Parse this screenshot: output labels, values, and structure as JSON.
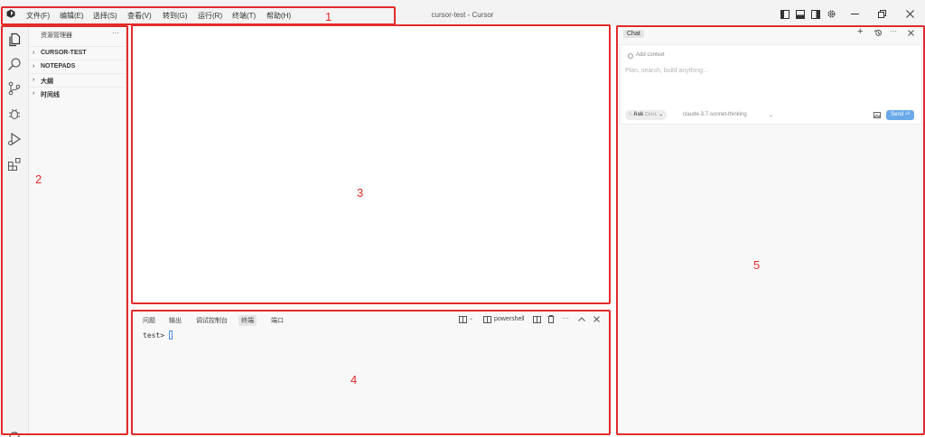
{
  "window": {
    "title": "cursor-test - Cursor",
    "menu": [
      "文件(F)",
      "编辑(E)",
      "选择(S)",
      "查看(V)",
      "转到(G)",
      "运行(R)",
      "终端(T)",
      "帮助(H)"
    ]
  },
  "activity_bar": {
    "icons": [
      "explorer-icon",
      "search-icon",
      "source-control-icon",
      "debug-icon",
      "run-icon",
      "extensions-icon"
    ]
  },
  "sidebar": {
    "title": "资源管理器",
    "more": "···",
    "sections": [
      "CURSOR-TEST",
      "NOTEPADS",
      "大纲",
      "时间线"
    ]
  },
  "panel": {
    "tabs": [
      "问题",
      "输出",
      "调试控制台",
      "终端",
      "端口"
    ],
    "active_tab": "终端",
    "shell_label": "powershell",
    "prompt": "test>"
  },
  "chat": {
    "tab_label": "Chat",
    "add_context": "Add context",
    "placeholder": "Plan, search, build anything...",
    "mode_label": "Ask",
    "mode_shortcut": "Ctrl+L",
    "model_label": "claude-3.7-sonnet-thinking",
    "send_label": "Send",
    "accent_color": "#6aa9e9"
  },
  "annotations": {
    "labels": [
      "1",
      "2",
      "3",
      "4",
      "5"
    ],
    "color": "#e32b2b"
  }
}
